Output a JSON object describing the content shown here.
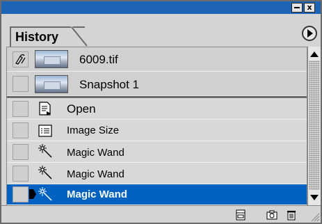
{
  "panel": {
    "tab_label": "History"
  },
  "titlebar": {
    "close_glyph": "x"
  },
  "snapshots": [
    {
      "label": "6009.tif",
      "icon": "history-brush-icon"
    },
    {
      "label": "Snapshot 1",
      "icon": ""
    }
  ],
  "states": [
    {
      "label": "Open",
      "icon": "open-document-icon",
      "active": false
    },
    {
      "label": "Image Size",
      "icon": "image-size-icon",
      "active": false
    },
    {
      "label": "Magic Wand",
      "icon": "magic-wand-icon",
      "active": false
    },
    {
      "label": "Magic Wand",
      "icon": "magic-wand-icon",
      "active": false
    },
    {
      "label": "Magic Wand",
      "icon": "magic-wand-icon",
      "active": true
    }
  ],
  "colors": {
    "titlebar": "#1e64b4",
    "selection": "#0062c0",
    "panel": "#d4d4d4"
  },
  "footer_icons": [
    "new-document-from-state-icon",
    "new-snapshot-camera-icon",
    "trash-icon"
  ]
}
